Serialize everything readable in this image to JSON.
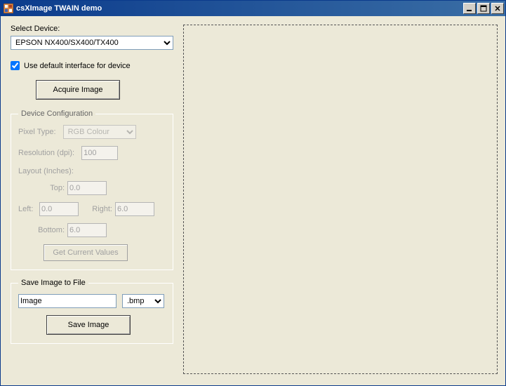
{
  "window": {
    "title": "csXImage TWAIN demo"
  },
  "selectDevice": {
    "label": "Select Device:",
    "value": "EPSON NX400/SX400/TX400"
  },
  "defaultInterface": {
    "label": "Use default interface for device",
    "checked": true
  },
  "acquire": {
    "label": "Acquire Image"
  },
  "deviceConfig": {
    "legend": "Device Configuration",
    "pixelType": {
      "label": "Pixel Type:",
      "value": "RGB Colour"
    },
    "resolution": {
      "label": "Resolution (dpi):",
      "value": "100"
    },
    "layout": {
      "label": "Layout (Inches):",
      "top": {
        "label": "Top:",
        "value": "0.0"
      },
      "left": {
        "label": "Left:",
        "value": "0.0"
      },
      "right": {
        "label": "Right:",
        "value": "6.0"
      },
      "bottom": {
        "label": "Bottom:",
        "value": "6.0"
      }
    },
    "getCurrent": {
      "label": "Get Current Values"
    }
  },
  "saveImage": {
    "legend": "Save Image to File",
    "filename": "Image",
    "extension": ".bmp",
    "button": "Save Image"
  }
}
